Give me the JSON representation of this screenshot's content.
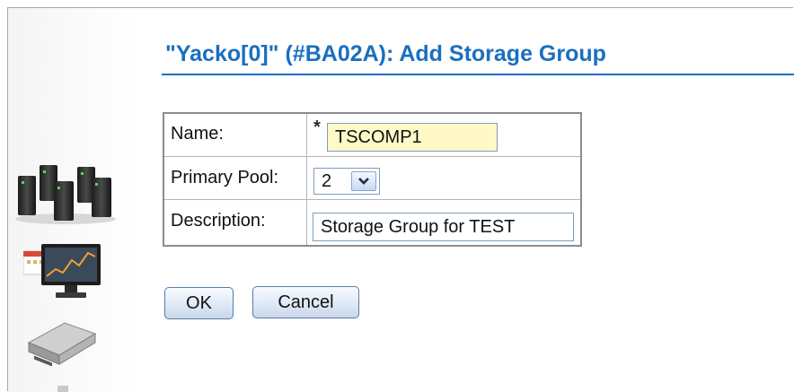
{
  "page": {
    "title": "\"Yacko[0]\" (#BA02A): Add Storage Group"
  },
  "sidebar": {
    "icons": [
      "servers-icon",
      "performance-monitor-icon",
      "storage-drive-icon"
    ]
  },
  "form": {
    "name": {
      "label": "Name:",
      "required_mark": "*",
      "value": "TSCOMP1"
    },
    "primary_pool": {
      "label": "Primary Pool:",
      "value": "2"
    },
    "description": {
      "label": "Description:",
      "value": "Storage Group for TEST"
    }
  },
  "buttons": {
    "ok_label": "OK",
    "cancel_label": "Cancel"
  },
  "colors": {
    "title": "#1a6fc0",
    "required_field_bg": "#fff9c8"
  }
}
